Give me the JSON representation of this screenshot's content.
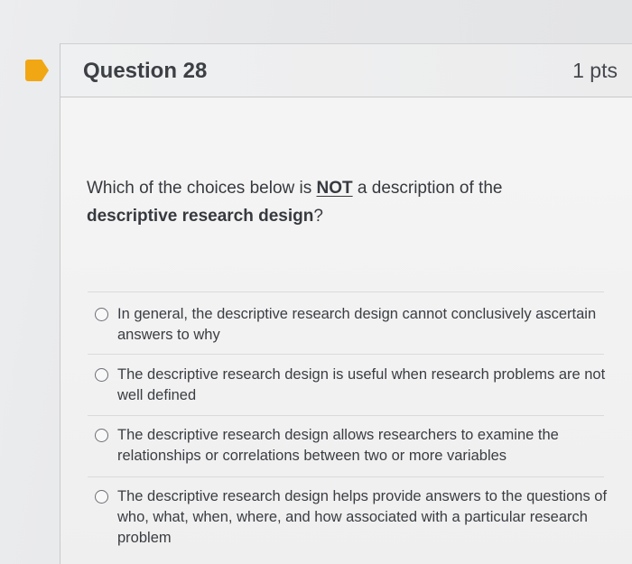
{
  "question": {
    "title": "Question 28",
    "points": "1 pts",
    "prompt": {
      "before": "Which of the choices below is ",
      "emphasis": "NOT",
      "middle": " a description of the ",
      "bold_phrase": "descriptive research design",
      "after": "?"
    },
    "answers": [
      {
        "label": "In general, the descriptive research design cannot conclusively ascertain answers to why"
      },
      {
        "label": "The descriptive research design is useful when research problems are not well defined"
      },
      {
        "label": "The descriptive research design allows researchers to examine the relationships or correlations between two or more variables"
      },
      {
        "label": "The descriptive research design helps provide answers to the questions of who, what, when, where, and how associated with a particular research problem"
      }
    ]
  },
  "colors": {
    "marker": "#f1a714",
    "text": "#3a3d42",
    "header_bg": "#eff0f1"
  }
}
